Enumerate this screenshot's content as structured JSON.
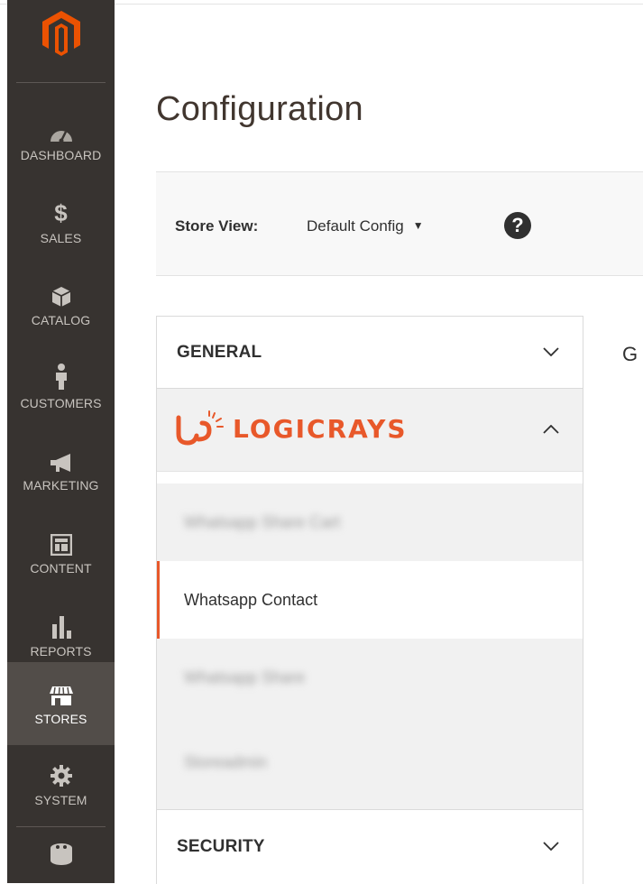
{
  "sidebar": {
    "logo": "magento-logo",
    "items": [
      {
        "label": "DASHBOARD",
        "icon": "dashboard-gauge-icon",
        "active": false
      },
      {
        "label": "SALES",
        "icon": "dollar-icon",
        "active": false
      },
      {
        "label": "CATALOG",
        "icon": "cube-icon",
        "active": false
      },
      {
        "label": "CUSTOMERS",
        "icon": "person-icon",
        "active": false
      },
      {
        "label": "MARKETING",
        "icon": "megaphone-icon",
        "active": false
      },
      {
        "label": "CONTENT",
        "icon": "layout-icon",
        "active": false
      },
      {
        "label": "REPORTS",
        "icon": "bar-chart-icon",
        "active": false
      },
      {
        "label": "STORES",
        "icon": "store-icon",
        "active": true
      },
      {
        "label": "SYSTEM",
        "icon": "gear-icon",
        "active": false
      }
    ]
  },
  "page": {
    "title": "Configuration"
  },
  "store_switcher": {
    "label": "Store View:",
    "value": "Default Config",
    "help_icon": "question-icon"
  },
  "config_tabs": {
    "general": {
      "label": "GENERAL",
      "icon": "chevron-down-icon"
    },
    "logicrays": {
      "brand": "LOGICRAYS",
      "icon": "chevron-up-icon",
      "items": [
        {
          "label": "Whatsapp Share Cart",
          "active": false
        },
        {
          "label": "Whatsapp Contact",
          "active": true
        },
        {
          "label": "Whatsapp Share",
          "active": false
        },
        {
          "label": "Storeadmin",
          "active": false
        }
      ]
    },
    "security": {
      "label": "SECURITY",
      "icon": "chevron-down-icon"
    }
  },
  "content_heading_partial": "G",
  "colors": {
    "sidebar_bg": "#373330",
    "sidebar_active": "#524d49",
    "brand_orange": "#e8582a",
    "magento_orange": "#eb5202"
  }
}
